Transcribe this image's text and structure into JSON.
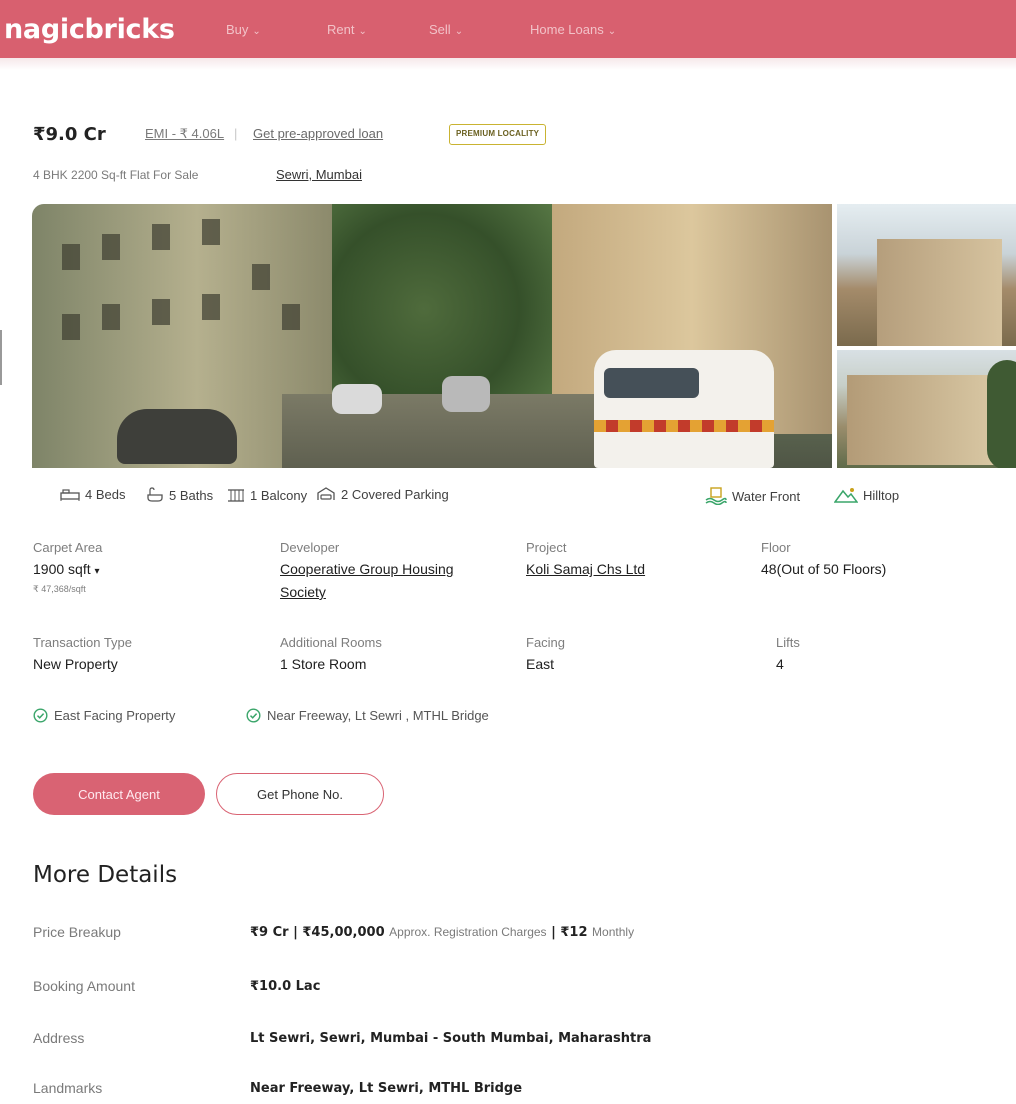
{
  "header": {
    "logo": "nagicbricks",
    "nav": [
      {
        "label": "Buy"
      },
      {
        "label": "Rent"
      },
      {
        "label": "Sell"
      },
      {
        "label": "Home Loans"
      }
    ]
  },
  "listing": {
    "price": "₹9.0 Cr",
    "emi": "EMI - ₹ 4.06L",
    "separator": "|",
    "loan_link": "Get pre-approved loan",
    "badge": "PREMIUM LOCALITY",
    "subtitle": "4 BHK 2200 Sq-ft Flat For Sale",
    "locality": "Sewri, Mumbai"
  },
  "amenities": [
    {
      "icon": "bed-icon",
      "label": "4 Beds"
    },
    {
      "icon": "bath-icon",
      "label": "5 Baths"
    },
    {
      "icon": "balcony-icon",
      "label": "1 Balcony"
    },
    {
      "icon": "parking-icon",
      "label": "2 Covered Parking"
    }
  ],
  "highlights": [
    {
      "icon": "water-front-icon",
      "label": "Water Front"
    },
    {
      "icon": "hilltop-icon",
      "label": "Hilltop"
    }
  ],
  "details": {
    "carpet_area": {
      "label": "Carpet Area",
      "value": "1900 sqft",
      "sub": "₹ 47,368/sqft"
    },
    "developer": {
      "label": "Developer",
      "value_line1": "Cooperative Group Housing",
      "value_line2": "Society"
    },
    "project": {
      "label": "Project",
      "value": "Koli Samaj Chs Ltd"
    },
    "floor": {
      "label": "Floor",
      "value": "48(Out of 50 Floors)"
    },
    "transaction": {
      "label": "Transaction Type",
      "value": "New Property"
    },
    "rooms": {
      "label": "Additional Rooms",
      "value": "1 Store Room"
    },
    "facing": {
      "label": "Facing",
      "value": "East"
    },
    "lifts": {
      "label": "Lifts",
      "value": "4"
    }
  },
  "features": [
    {
      "label": "East Facing Property"
    },
    {
      "label": "Near Freeway, Lt Sewri , MTHL Bridge"
    }
  ],
  "actions": {
    "contact": "Contact Agent",
    "phone": "Get Phone No."
  },
  "more_details": {
    "title": "More Details",
    "rows": [
      {
        "label": "Price Breakup",
        "value": "₹9 Cr | ₹45,00,000",
        "extra": "Approx. Registration Charges",
        "value2": "| ₹12",
        "extra2": "Monthly"
      },
      {
        "label": "Booking Amount",
        "value": "₹10.0 Lac"
      },
      {
        "label": "Address",
        "value": "Lt Sewri, Sewri, Mumbai - South Mumbai, Maharashtra"
      },
      {
        "label": "Landmarks",
        "value": "Near Freeway, Lt Sewri, MTHL Bridge"
      }
    ]
  },
  "colors": {
    "brand": "#d8606f",
    "badge_border": "#c9b331",
    "check_green": "#3aa56a"
  }
}
